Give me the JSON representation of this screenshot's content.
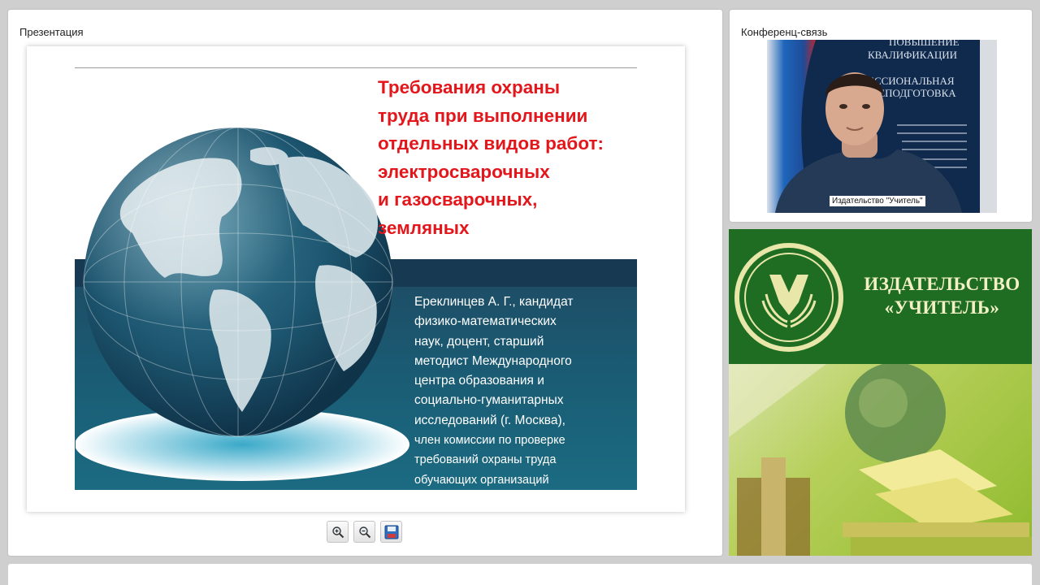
{
  "presentation_panel": {
    "title": "Презентация",
    "slide": {
      "title_lines": [
        "Требования охраны",
        "труда при выполнении",
        "отдельных видов работ:",
        "электросварочных",
        "и газосварочных,",
        "земляных"
      ],
      "author_lines": [
        "Ереклинцев А. Г., кандидат",
        "физико-математических",
        "наук, доцент, старший",
        "методист Международного",
        "центра образования и",
        "социально-гуманитарных",
        "исследований (г. Москва),",
        "член комиссии по проверке",
        "требований охраны труда",
        "обучающих организаций"
      ],
      "title_color": "#e3161b",
      "band_color": "#1a5a72"
    },
    "toolbar": {
      "buttons": [
        {
          "icon": "zoom-in-icon"
        },
        {
          "icon": "zoom-out-icon"
        },
        {
          "icon": "save-icon"
        }
      ]
    }
  },
  "conference_panel": {
    "title": "Конференц-связь",
    "video": {
      "speaker_label": "Издательство \"Учитель\"",
      "backdrop_lines": [
        "ПОВЫШЕНИЕ",
        "КВАЛИФИКАЦИИ",
        "ЕССИОНАЛЬНАЯ",
        "РЕПОДГОТОВКА"
      ]
    }
  },
  "publisher_banner": {
    "name_lines": [
      "ИЗДАТЕЛЬСТВО",
      "«УЧИТЕЛЬ»"
    ],
    "accent_color": "#1e6d22"
  }
}
